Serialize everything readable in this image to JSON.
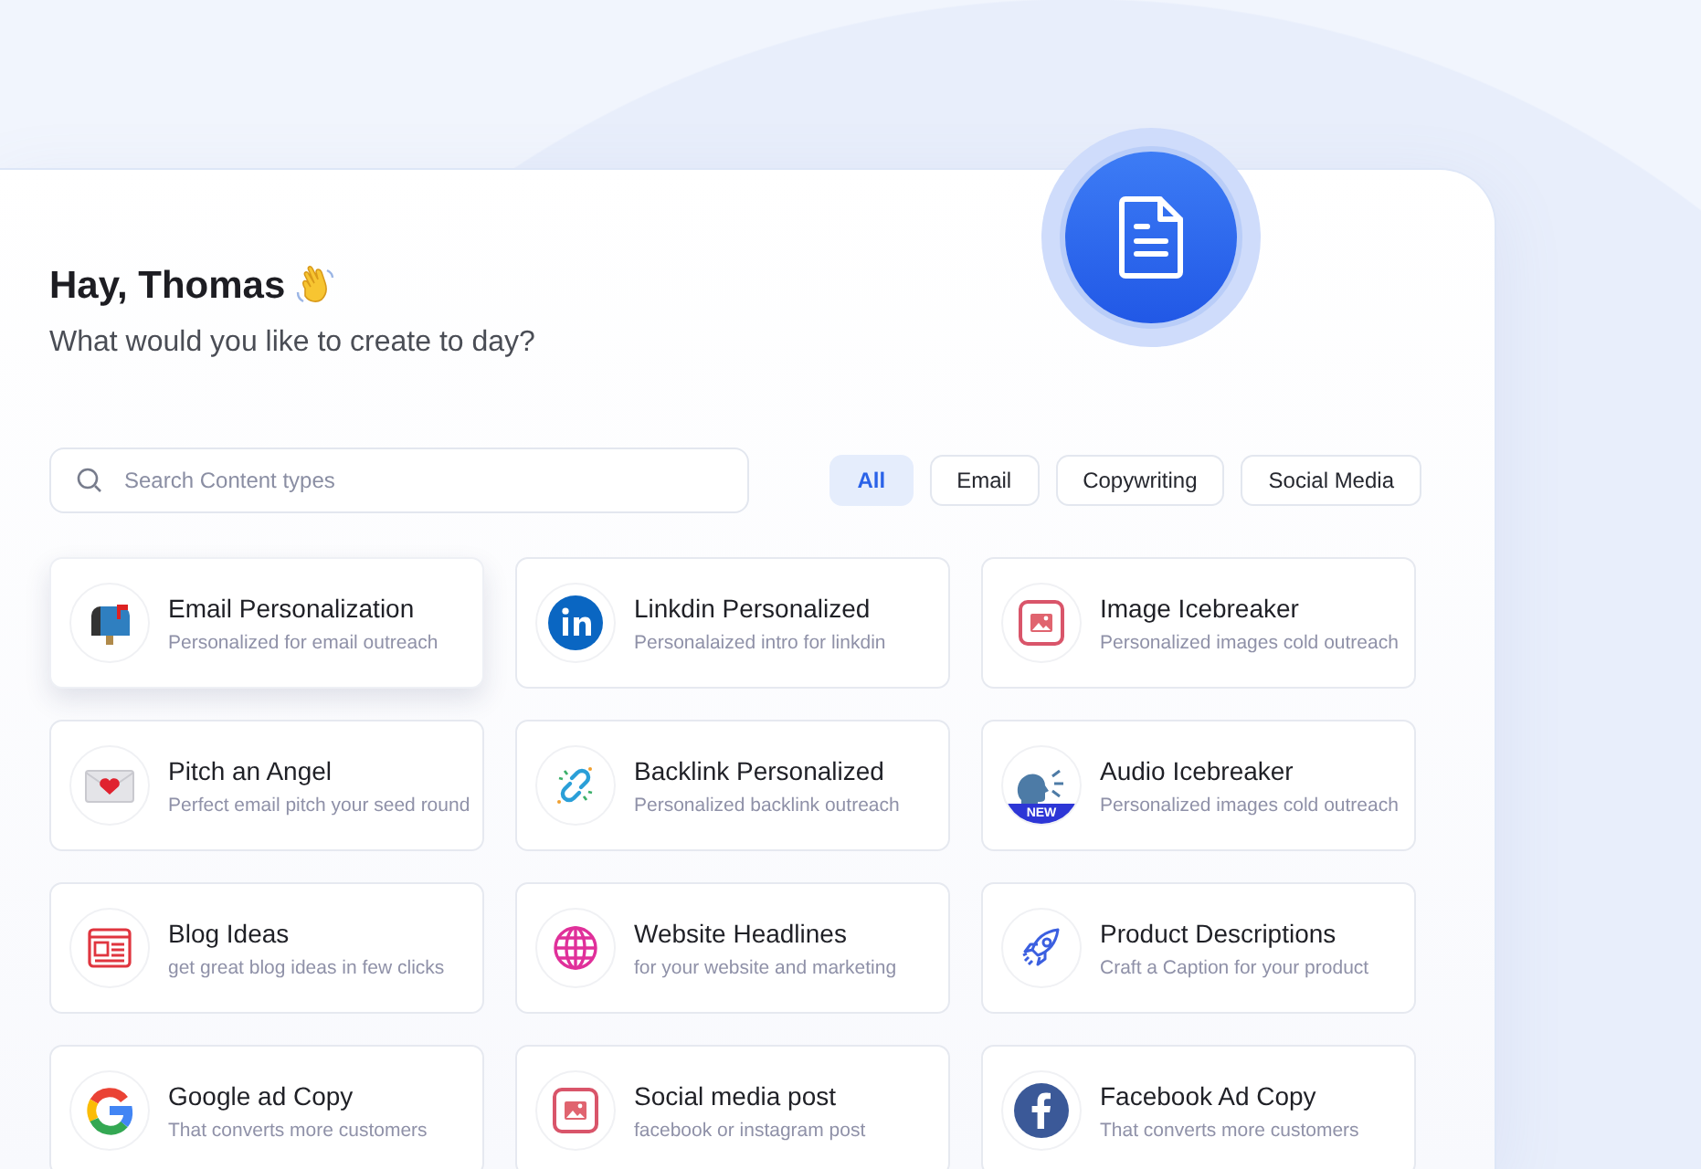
{
  "greeting": {
    "title": "Hay, Thomas",
    "subtitle": "What would you like to create to day?"
  },
  "search": {
    "placeholder": "Search Content types"
  },
  "filters": [
    {
      "label": "All",
      "selected": true
    },
    {
      "label": "Email",
      "selected": false
    },
    {
      "label": "Copywriting",
      "selected": false
    },
    {
      "label": "Social Media",
      "selected": false
    }
  ],
  "cards": [
    {
      "kind": "mailbox",
      "title": "Email Personalization",
      "description": "Personalized for email outreach",
      "selected": true
    },
    {
      "kind": "linkedin",
      "title": "Linkdin Personalized",
      "description": "Personalaized intro for linkdin",
      "selected": false
    },
    {
      "kind": "image",
      "title": "Image Icebreaker",
      "description": "Personalized images cold outreach",
      "selected": false
    },
    {
      "kind": "heart-mail",
      "title": "Pitch an Angel",
      "description": "Perfect email pitch your seed round",
      "selected": false
    },
    {
      "kind": "link",
      "title": "Backlink Personalized",
      "description": "Personalized backlink outreach",
      "selected": false
    },
    {
      "kind": "speaker",
      "title": "Audio Icebreaker",
      "description": "Personalized images cold outreach",
      "badge": "NEW",
      "selected": false
    },
    {
      "kind": "blog",
      "title": "Blog Ideas",
      "description": "get great blog ideas in few clicks",
      "selected": false
    },
    {
      "kind": "globe",
      "title": "Website Headlines",
      "description": "for your website and marketing",
      "selected": false
    },
    {
      "kind": "rocket",
      "title": "Product Descriptions",
      "description": "Craft a Caption for your product",
      "selected": false
    },
    {
      "kind": "google",
      "title": "Google ad Copy",
      "description": "That converts more customers",
      "selected": false
    },
    {
      "kind": "image",
      "title": "Social media post",
      "description": "facebook or instagram post",
      "selected": false
    },
    {
      "kind": "facebook",
      "title": "Facebook Ad Copy",
      "description": "That converts more customers",
      "selected": false
    }
  ]
}
